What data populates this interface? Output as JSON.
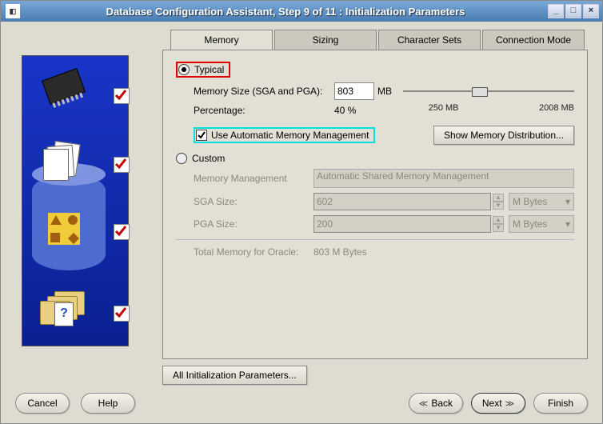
{
  "window": {
    "title": "Database Configuration Assistant, Step 9 of 11 : Initialization Parameters"
  },
  "tabs": {
    "memory": "Memory",
    "sizing": "Sizing",
    "charsets": "Character Sets",
    "connmode": "Connection Mode"
  },
  "memory": {
    "typical_label": "Typical",
    "memsize_label": "Memory Size (SGA and PGA):",
    "memsize_value": "803",
    "memsize_unit": "MB",
    "percentage_label": "Percentage:",
    "percentage_value": "40 %",
    "slider_mid": "250 MB",
    "slider_max": "2008 MB",
    "use_amm_label": "Use Automatic Memory Management",
    "show_dist_label": "Show Memory Distribution...",
    "custom_label": "Custom",
    "mm_label": "Memory Management",
    "mm_value": "Automatic Shared Memory Management",
    "sga_label": "SGA Size:",
    "sga_value": "602",
    "pga_label": "PGA Size:",
    "pga_value": "200",
    "unit_value": "M Bytes",
    "total_label": "Total Memory for Oracle:",
    "total_value": "803 M Bytes"
  },
  "all_params_label": "All Initialization Parameters...",
  "footer": {
    "cancel": "Cancel",
    "help": "Help",
    "back": "Back",
    "next": "Next",
    "finish": "Finish"
  }
}
